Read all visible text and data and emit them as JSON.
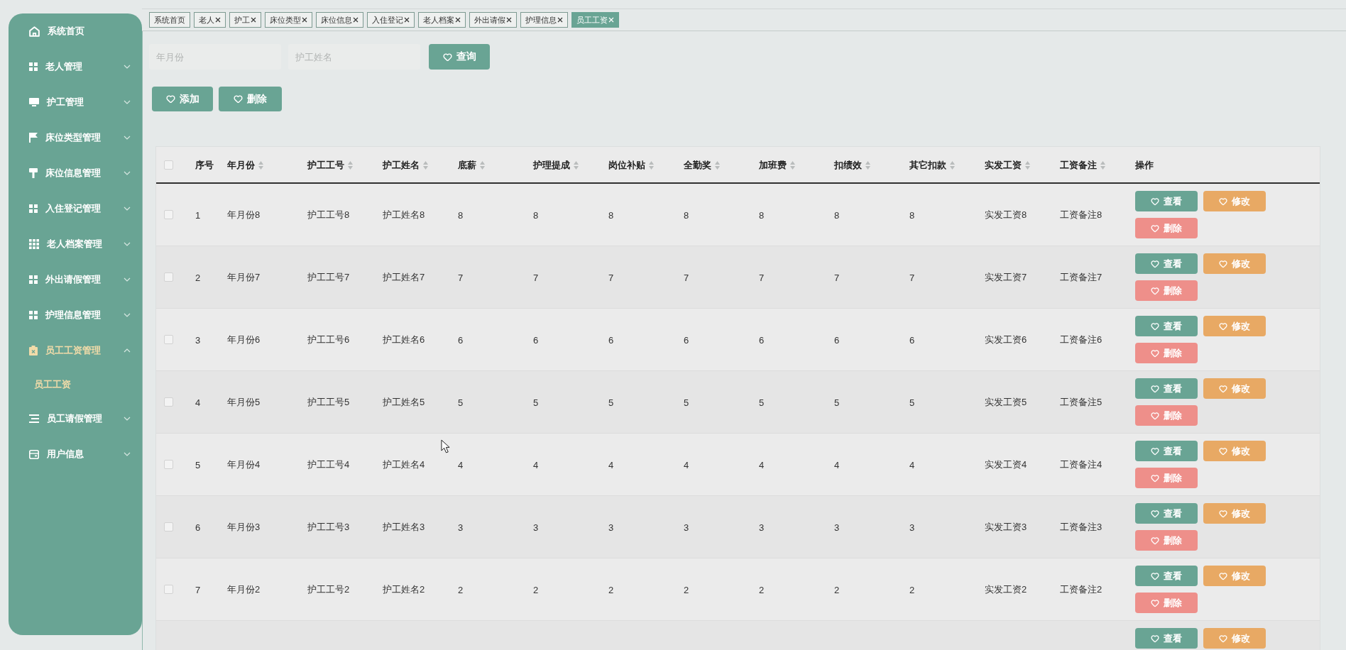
{
  "sidebar": {
    "items": [
      {
        "label": "系统首页",
        "kind": "link",
        "selected": false
      },
      {
        "label": "老人管理",
        "kind": "group",
        "selected": false,
        "expanded": false
      },
      {
        "label": "护工管理",
        "kind": "group",
        "selected": false,
        "expanded": false
      },
      {
        "label": "床位类型管理",
        "kind": "group",
        "selected": false,
        "expanded": false
      },
      {
        "label": "床位信息管理",
        "kind": "group",
        "selected": false,
        "expanded": false
      },
      {
        "label": "入住登记管理",
        "kind": "group",
        "selected": false,
        "expanded": false
      },
      {
        "label": "老人档案管理",
        "kind": "group",
        "selected": false,
        "expanded": false
      },
      {
        "label": "外出请假管理",
        "kind": "group",
        "selected": false,
        "expanded": false
      },
      {
        "label": "护理信息管理",
        "kind": "group",
        "selected": false,
        "expanded": false
      },
      {
        "label": "员工工资管理",
        "kind": "group",
        "selected": true,
        "expanded": true,
        "children": [
          {
            "label": "员工工资",
            "selected": true
          }
        ]
      },
      {
        "label": "员工请假管理",
        "kind": "group",
        "selected": false,
        "expanded": false
      },
      {
        "label": "用户信息",
        "kind": "group",
        "selected": false,
        "expanded": false
      }
    ]
  },
  "tabs": [
    {
      "label": "系统首页",
      "closable": false,
      "selected": false
    },
    {
      "label": "老人",
      "closable": true,
      "selected": false
    },
    {
      "label": "护工",
      "closable": true,
      "selected": false
    },
    {
      "label": "床位类型",
      "closable": true,
      "selected": false
    },
    {
      "label": "床位信息",
      "closable": true,
      "selected": false
    },
    {
      "label": "入住登记",
      "closable": true,
      "selected": false
    },
    {
      "label": "老人档案",
      "closable": true,
      "selected": false
    },
    {
      "label": "外出请假",
      "closable": true,
      "selected": false
    },
    {
      "label": "护理信息",
      "closable": true,
      "selected": false
    },
    {
      "label": "员工工资",
      "closable": true,
      "selected": true
    }
  ],
  "search": {
    "fields": [
      {
        "placeholder": "年月份"
      },
      {
        "placeholder": "护工姓名"
      }
    ],
    "button": "查询"
  },
  "toolbar": {
    "buttons": [
      {
        "label": "添加"
      },
      {
        "label": "删除"
      }
    ]
  },
  "table": {
    "header_checkbox": {
      "checked": false
    },
    "columns": [
      {
        "label": "序号",
        "sortable": false
      },
      {
        "label": "年月份",
        "sortable": true
      },
      {
        "label": "护工工号",
        "sortable": true
      },
      {
        "label": "护工姓名",
        "sortable": true
      },
      {
        "label": "底薪",
        "sortable": true
      },
      {
        "label": "护理提成",
        "sortable": true
      },
      {
        "label": "岗位补贴",
        "sortable": true
      },
      {
        "label": "全勤奖",
        "sortable": true
      },
      {
        "label": "加班费",
        "sortable": true
      },
      {
        "label": "扣绩效",
        "sortable": true
      },
      {
        "label": "其它扣款",
        "sortable": true
      },
      {
        "label": "实发工资",
        "sortable": true
      },
      {
        "label": "工资备注",
        "sortable": true
      },
      {
        "label": "操作",
        "sortable": false
      }
    ],
    "rows": [
      {
        "checked": false,
        "cells": [
          "1",
          "年月份8",
          "护工工号8",
          "护工姓名8",
          "8",
          "8",
          "8",
          "8",
          "8",
          "8",
          "8",
          "实发工资8",
          "工资备注8"
        ],
        "actions": [
          {
            "label": "查看",
            "kind": "view"
          },
          {
            "label": "修改",
            "kind": "edit"
          },
          {
            "label": "删除",
            "kind": "delete"
          }
        ]
      },
      {
        "checked": false,
        "cells": [
          "2",
          "年月份7",
          "护工工号7",
          "护工姓名7",
          "7",
          "7",
          "7",
          "7",
          "7",
          "7",
          "7",
          "实发工资7",
          "工资备注7"
        ],
        "actions": [
          {
            "label": "查看",
            "kind": "view"
          },
          {
            "label": "修改",
            "kind": "edit"
          },
          {
            "label": "删除",
            "kind": "delete"
          }
        ]
      },
      {
        "checked": false,
        "cells": [
          "3",
          "年月份6",
          "护工工号6",
          "护工姓名6",
          "6",
          "6",
          "6",
          "6",
          "6",
          "6",
          "6",
          "实发工资6",
          "工资备注6"
        ],
        "actions": [
          {
            "label": "查看",
            "kind": "view"
          },
          {
            "label": "修改",
            "kind": "edit"
          },
          {
            "label": "删除",
            "kind": "delete"
          }
        ]
      },
      {
        "checked": false,
        "cells": [
          "4",
          "年月份5",
          "护工工号5",
          "护工姓名5",
          "5",
          "5",
          "5",
          "5",
          "5",
          "5",
          "5",
          "实发工资5",
          "工资备注5"
        ],
        "actions": [
          {
            "label": "查看",
            "kind": "view"
          },
          {
            "label": "修改",
            "kind": "edit"
          },
          {
            "label": "删除",
            "kind": "delete"
          }
        ]
      },
      {
        "checked": false,
        "cells": [
          "5",
          "年月份4",
          "护工工号4",
          "护工姓名4",
          "4",
          "4",
          "4",
          "4",
          "4",
          "4",
          "4",
          "实发工资4",
          "工资备注4"
        ],
        "actions": [
          {
            "label": "查看",
            "kind": "view"
          },
          {
            "label": "修改",
            "kind": "edit"
          },
          {
            "label": "删除",
            "kind": "delete"
          }
        ]
      },
      {
        "checked": false,
        "cells": [
          "6",
          "年月份3",
          "护工工号3",
          "护工姓名3",
          "3",
          "3",
          "3",
          "3",
          "3",
          "3",
          "3",
          "实发工资3",
          "工资备注3"
        ],
        "actions": [
          {
            "label": "查看",
            "kind": "view"
          },
          {
            "label": "修改",
            "kind": "edit"
          },
          {
            "label": "删除",
            "kind": "delete"
          }
        ]
      },
      {
        "checked": false,
        "cells": [
          "7",
          "年月份2",
          "护工工号2",
          "护工姓名2",
          "2",
          "2",
          "2",
          "2",
          "2",
          "2",
          "2",
          "实发工资2",
          "工资备注2"
        ],
        "actions": [
          {
            "label": "查看",
            "kind": "view"
          },
          {
            "label": "修改",
            "kind": "edit"
          },
          {
            "label": "删除",
            "kind": "delete"
          }
        ]
      },
      {
        "actions": [
          {
            "label": "查看",
            "kind": "view"
          },
          {
            "label": "修改",
            "kind": "edit"
          }
        ]
      }
    ]
  }
}
